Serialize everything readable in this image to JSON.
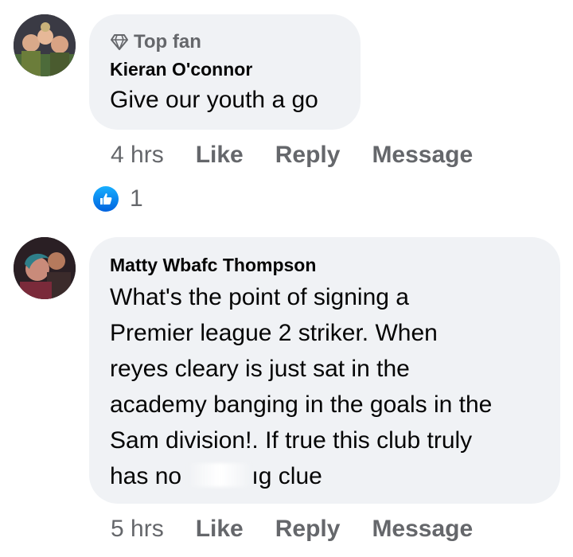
{
  "comments": [
    {
      "badge": "Top fan",
      "badge_icon": "diamond-icon",
      "author": "Kieran O'connor",
      "lines": [
        "Give our youth a go"
      ],
      "time": "4 hrs",
      "like_label": "Like",
      "reply_label": "Reply",
      "message_label": "Message",
      "reaction_icon": "thumbs-up-icon",
      "reaction_count": "1"
    },
    {
      "author": "Matty Wbafc Thompson",
      "lines": [
        "What's the point of signing a",
        "Premier league 2 striker. When",
        "reyes cleary is just sat in the",
        "academy banging in the goals in the",
        "Sam division!. If true this club truly"
      ],
      "last_line_start": "has no",
      "last_line_end": "ıg clue",
      "time": "5 hrs",
      "like_label": "Like",
      "reply_label": "Reply",
      "message_label": "Message"
    }
  ],
  "colors": {
    "bubble": "#f0f2f5",
    "text": "#050505",
    "secondary": "#65676b",
    "like_blue": "#0866ff"
  }
}
